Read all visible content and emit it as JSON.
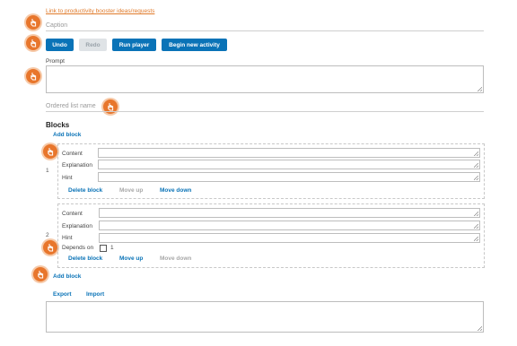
{
  "top_link": "Link to productivity booster ideas/requests",
  "caption_placeholder": "Caption",
  "toolbar": {
    "undo": "Undo",
    "redo": "Redo",
    "run_player": "Run player",
    "begin_new_activity": "Begin new activity"
  },
  "prompt_label": "Prompt",
  "ordered_list_placeholder": "Ordered list name",
  "blocks_heading": "Blocks",
  "add_block": "Add block",
  "block_fields": {
    "content": "Content",
    "explanation": "Explanation",
    "hint": "Hint",
    "depends_on": "Depends on"
  },
  "blocks": [
    {
      "index": "1",
      "delete": "Delete block",
      "move_up": "Move up",
      "move_down": "Move down"
    },
    {
      "index": "2",
      "delete": "Delete block",
      "move_up": "Move up",
      "move_down": "Move down",
      "depends_on_value": "1"
    }
  ],
  "add_block_bottom": "Add block",
  "export": "Export",
  "import": "Import",
  "colors": {
    "accent": "#0a73b7",
    "hint": "#e8762c",
    "link": "#e07a2a"
  },
  "icons": [
    "hand-pointer-icon"
  ]
}
